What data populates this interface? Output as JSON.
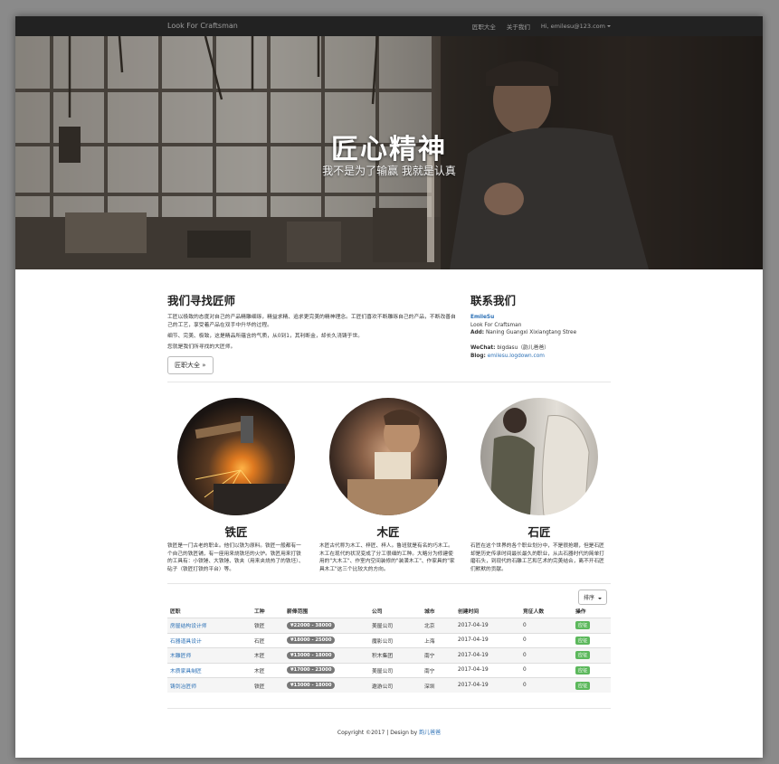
{
  "navbar": {
    "brand": "Look For Craftsman",
    "links": [
      "匠职大全",
      "关于我们"
    ],
    "user": "Hi, emilesu@123.com"
  },
  "hero": {
    "title": "匠心精神",
    "subtitle": "我不是为了输赢 我就是认真"
  },
  "intro": {
    "heading": "我们寻找匠师",
    "p1": "工匠以极致的态度对自己的产品精雕细琢，精益求精、追求更完美的精神理念。工匠们喜欢不断雕琢自己的产品，不断改善自己的工艺，享受着产品在双手中升华的过程。",
    "p2": "细节、完美、极致，这是精品所蕴含的气质，从0到1，其利断金，却长久浇铸于世。",
    "p3": "您就是我们所寻找的大匠师。",
    "button": "匠职大全 »"
  },
  "contact": {
    "heading": "联系我们",
    "name": "EmileSu",
    "company": "Look For Craftsman",
    "addr_label": "Add:",
    "addr": "Naning Guangxi Xixiangtang Stree",
    "wechat_label": "WeChat:",
    "wechat": "bigdasu（韵儿爸爸）",
    "blog_label": "Blog:",
    "blog": "emilesu.logdown.com"
  },
  "crafts": [
    {
      "title": "铁匠",
      "desc": "铁匠是一门古老的职业。他们以铁为原料。铁匠一般都有一个自己的铁匠铺，有一座用来烧铁坯的火炉。铁匠用来打铁的工具有：小铁锤、大铁锤、铁夹（用来夹烧热了的铁坯）、砧子（铁匠打铁的平台）等。"
    },
    {
      "title": "木匠",
      "desc": "木匠古代称为木工、梓匠、梓人。鲁班就是有名的巧木工。木工在现代的状况变成了分工很细的工种。大略分为修建使用的\"大木工\"、作室内空间装修的\"装潢木工\"、作家具的\"家具木工\"这三个比较大的方向。"
    },
    {
      "title": "石匠",
      "desc": "石匠在这个世界的各个职业划分中，不是很抢眼，但是石匠却是历史传承时间最长最久的职业，从古石器时代的简单打磨石头，到现代的石雕工艺和艺术的完美结合，离不开石匠们默默的贡献。"
    }
  ],
  "table": {
    "sort_label": "排序",
    "headers": [
      "匠职",
      "工种",
      "薪俸范围",
      "公司",
      "城市",
      "创建时间",
      "竞征人数",
      "操作"
    ],
    "rows": [
      {
        "job": "房屋结构设计师",
        "type": "铁匠",
        "salary": "¥22000 - 38000",
        "company": "美屋公司",
        "city": "北京",
        "date": "2017-04-19",
        "count": "0",
        "action": "应征"
      },
      {
        "job": "石器道具设计",
        "type": "石匠",
        "salary": "¥18000 - 25000",
        "company": "魔影公司",
        "city": "上海",
        "date": "2017-04-19",
        "count": "0",
        "action": "应征"
      },
      {
        "job": "木雕匠师",
        "type": "木匠",
        "salary": "¥13000 - 18000",
        "company": "积木集团",
        "city": "南宁",
        "date": "2017-04-19",
        "count": "0",
        "action": "应征"
      },
      {
        "job": "木质家具制匠",
        "type": "木匠",
        "salary": "¥17000 - 23000",
        "company": "美屋公司",
        "city": "南宁",
        "date": "2017-04-19",
        "count": "0",
        "action": "应征"
      },
      {
        "job": "铸剑冶匠师",
        "type": "铁匠",
        "salary": "¥13000 - 18000",
        "company": "遨游公司",
        "city": "深圳",
        "date": "2017-04-19",
        "count": "0",
        "action": "应征"
      }
    ]
  },
  "footer": {
    "text": "Copyright ©2017 | Design by",
    "link": "韵儿爸爸"
  }
}
